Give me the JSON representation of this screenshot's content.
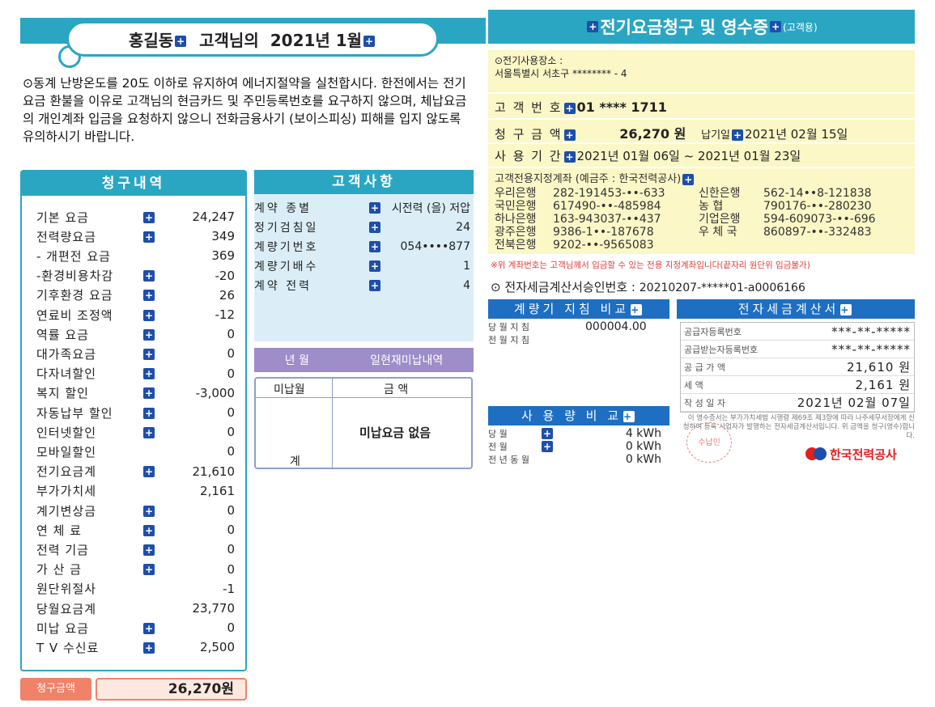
{
  "left_header": {
    "customer": "홍길동",
    "suffix": "고객님의",
    "period": "2021년 1월"
  },
  "notice": "⊙동계 난방온도를 20도 이하로 유지하여 에너지절약을 실천합시다. 한전에서는 전기요금 환불을 이유로 고객님의 현금카드 및 주민등록번호를 요구하지 않으며, 체납요금의 개인계좌 입금을 요청하지 않으니 전화금융사기 (보이스피싱) 피해를 입지 않도록 유의하시기 바랍니다.",
  "billing": {
    "title": "청구내역",
    "rows": [
      {
        "label": "기본    요금",
        "plus": true,
        "value": "24,247"
      },
      {
        "label": "전력량요금",
        "plus": true,
        "value": "349"
      },
      {
        "label": "- 개편전 요금",
        "plus": false,
        "value": "369"
      },
      {
        "label": "-환경비용차감",
        "plus": true,
        "value": "-20"
      },
      {
        "label": "기후환경 요금",
        "plus": true,
        "value": "26"
      },
      {
        "label": "연료비 조정액",
        "plus": true,
        "value": "-12"
      },
      {
        "label": "역률    요금",
        "plus": true,
        "value": "0"
      },
      {
        "label": "대가족요금",
        "plus": true,
        "value": "0"
      },
      {
        "label": "다자녀할인",
        "plus": true,
        "value": "0"
      },
      {
        "label": "복지    할인",
        "plus": true,
        "value": "-3,000"
      },
      {
        "label": "자동납부 할인",
        "plus": true,
        "value": "0"
      },
      {
        "label": "인터넷할인",
        "plus": true,
        "value": "0"
      },
      {
        "label": "모바일할인",
        "plus": false,
        "value": "0"
      },
      {
        "label": "전기요금계",
        "plus": true,
        "value": "21,610"
      },
      {
        "label": "부가가치세",
        "plus": false,
        "value": "2,161"
      },
      {
        "label": "계기변상금",
        "plus": true,
        "value": "0"
      },
      {
        "label": "연    체    료",
        "plus": true,
        "value": "0"
      },
      {
        "label": "전력     기금",
        "plus": true,
        "value": "0"
      },
      {
        "label": "가    산    금",
        "plus": true,
        "value": "0"
      },
      {
        "label": "원단위절사",
        "plus": false,
        "value": "-1"
      },
      {
        "label": "당월요금계",
        "plus": false,
        "value": "23,770"
      },
      {
        "label": "미납    요금",
        "plus": true,
        "value": "0"
      },
      {
        "label": "T V 수신료",
        "plus": true,
        "value": "2,500"
      }
    ],
    "total_label": "청구금액",
    "total_value": "26,270원"
  },
  "customer": {
    "title": "고객사항",
    "rows": [
      {
        "label": "계약       종별",
        "value": "주택용 저압"
      },
      {
        "label": "정기검침일",
        "value": "24"
      },
      {
        "label": "계량기번호",
        "value": "054••••877"
      },
      {
        "label": "계량기배수",
        "value": "1"
      },
      {
        "label": "계약       전력",
        "value": "4"
      }
    ],
    "contract_type_overlay": "시전력 (을) 저압"
  },
  "unpaid": {
    "head_left": "년    월",
    "head_right": "일현재미납내역",
    "col_month": "미납월",
    "col_amount": "금 액",
    "message": "미납요금 없음",
    "total_label": "계"
  },
  "receipt": {
    "title": "전기요금청구 및 영수증",
    "subtitle": "(고객용)",
    "place_label": "⊙전기사용장소 :",
    "place_value": "서울특별시  서초구       ********  - 4",
    "customer_no_label": "고 객 번 호",
    "customer_no_value": "01  ****  1711",
    "amount_label": "청 구 금 액",
    "amount_value": "26,270 원",
    "due_label": "납기일",
    "due_value": "2021년 02월 15일",
    "period_label": "사 용 기 간",
    "period_value": "2021년 01월 06일 ~ 2021년 01월 23일",
    "account_title": "고객전용지정계좌  (예금주 : 한국전력공사)",
    "banks": [
      {
        "bank": "우리은행",
        "acct": "282-191453-••-633"
      },
      {
        "bank": "신한은행",
        "acct": "562-14••8-121838"
      },
      {
        "bank": "국민은행",
        "acct": "617490-••-485984"
      },
      {
        "bank": "농      협",
        "acct": "790176-••-280230"
      },
      {
        "bank": "하나은행",
        "acct": "163-943037-••437"
      },
      {
        "bank": "기업은행",
        "acct": "594-609073-••-696"
      },
      {
        "bank": "광주은행",
        "acct": "9386-1••-187678"
      },
      {
        "bank": "우  체  국",
        "acct": "860897-••-332483"
      },
      {
        "bank": "전북은행",
        "acct": "9202-••-9565083"
      },
      {
        "bank": "",
        "acct": ""
      }
    ],
    "red_note": "※위 계좌번호는 고객님께서 입금할 수 있는 전용 지정계좌입니다(끝자리 원단위 입금불가)",
    "approval_label": "⊙  전자세금계산서승인번호  :",
    "approval_value": "20210207-*****01-a0006166"
  },
  "meter_compare": {
    "title": "계량기 지침 비교",
    "rows": [
      {
        "label": "당 월 지 침",
        "value": "000004.00"
      },
      {
        "label": "전 월 지 침",
        "value": ""
      }
    ]
  },
  "usage_compare": {
    "title": "사 용 량 비 교",
    "rows": [
      {
        "label": "당          월",
        "value": "4 kWh"
      },
      {
        "label": "전          월",
        "value": "0 kWh"
      },
      {
        "label": "전 년 동 월",
        "value": "0 kWh"
      }
    ]
  },
  "tax_invoice": {
    "title": "전자세금계산서",
    "rows": [
      {
        "label": "공급자등록번호",
        "value": "***-**-*****"
      },
      {
        "label": "공급받는자등록번호",
        "value": "***-**-*****"
      },
      {
        "label": "공    급    가    액",
        "value": "21,610 원"
      },
      {
        "label": "세                    액",
        "value": "2,161 원"
      },
      {
        "label": "작    성    일    자",
        "value": "2021년 02월 07일"
      }
    ],
    "fine_print": "이 영수증서는 부가가치세법 시행령 제69조 제3항에 따라 나주세무서장에게 신청하여 등록 사업자가 발행하는 전자세금계산서입니다. 위 금액을 청구(영수)합니다.",
    "stamp": "수납인",
    "company": "한국전력공사"
  }
}
